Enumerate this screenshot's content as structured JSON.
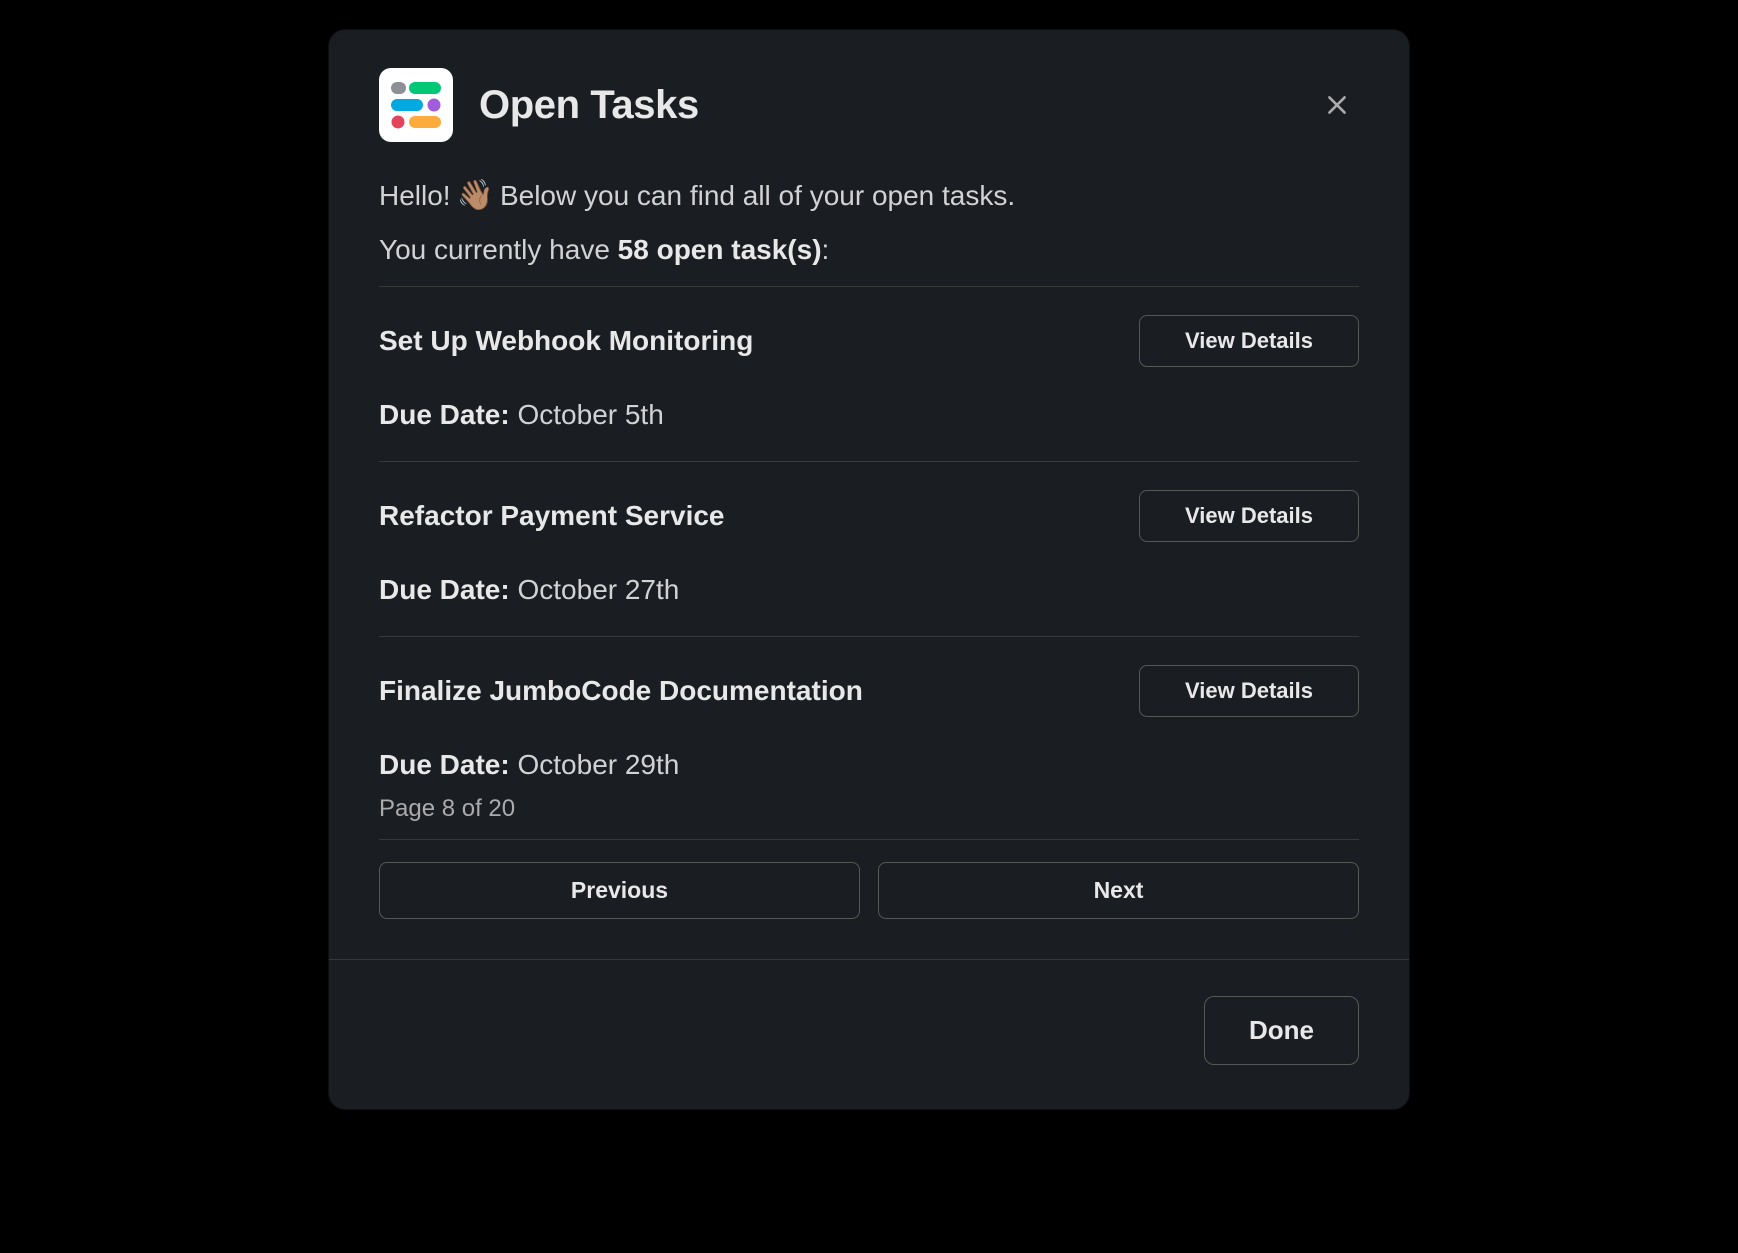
{
  "header": {
    "title": "Open Tasks",
    "icon": "monday-app-icon"
  },
  "intro": {
    "hello": "Hello!",
    "wave_emoji": "👋🏽",
    "rest": "Below you can find all of your open tasks."
  },
  "count_line": {
    "prefix": "You currently have ",
    "bold": "58 open task(s)",
    "suffix": ":"
  },
  "tasks": [
    {
      "title": "Set Up Webhook Monitoring",
      "due_label": "Due Date:",
      "due_value": "October 5th",
      "action_label": "View Details"
    },
    {
      "title": "Refactor Payment Service",
      "due_label": "Due Date:",
      "due_value": "October 27th",
      "action_label": "View Details"
    },
    {
      "title": "Finalize JumboCode Documentation",
      "due_label": "Due Date:",
      "due_value": "October 29th",
      "action_label": "View Details"
    }
  ],
  "pagination": {
    "label": "Page 8 of 20",
    "previous_label": "Previous",
    "next_label": "Next"
  },
  "footer": {
    "done_label": "Done"
  }
}
